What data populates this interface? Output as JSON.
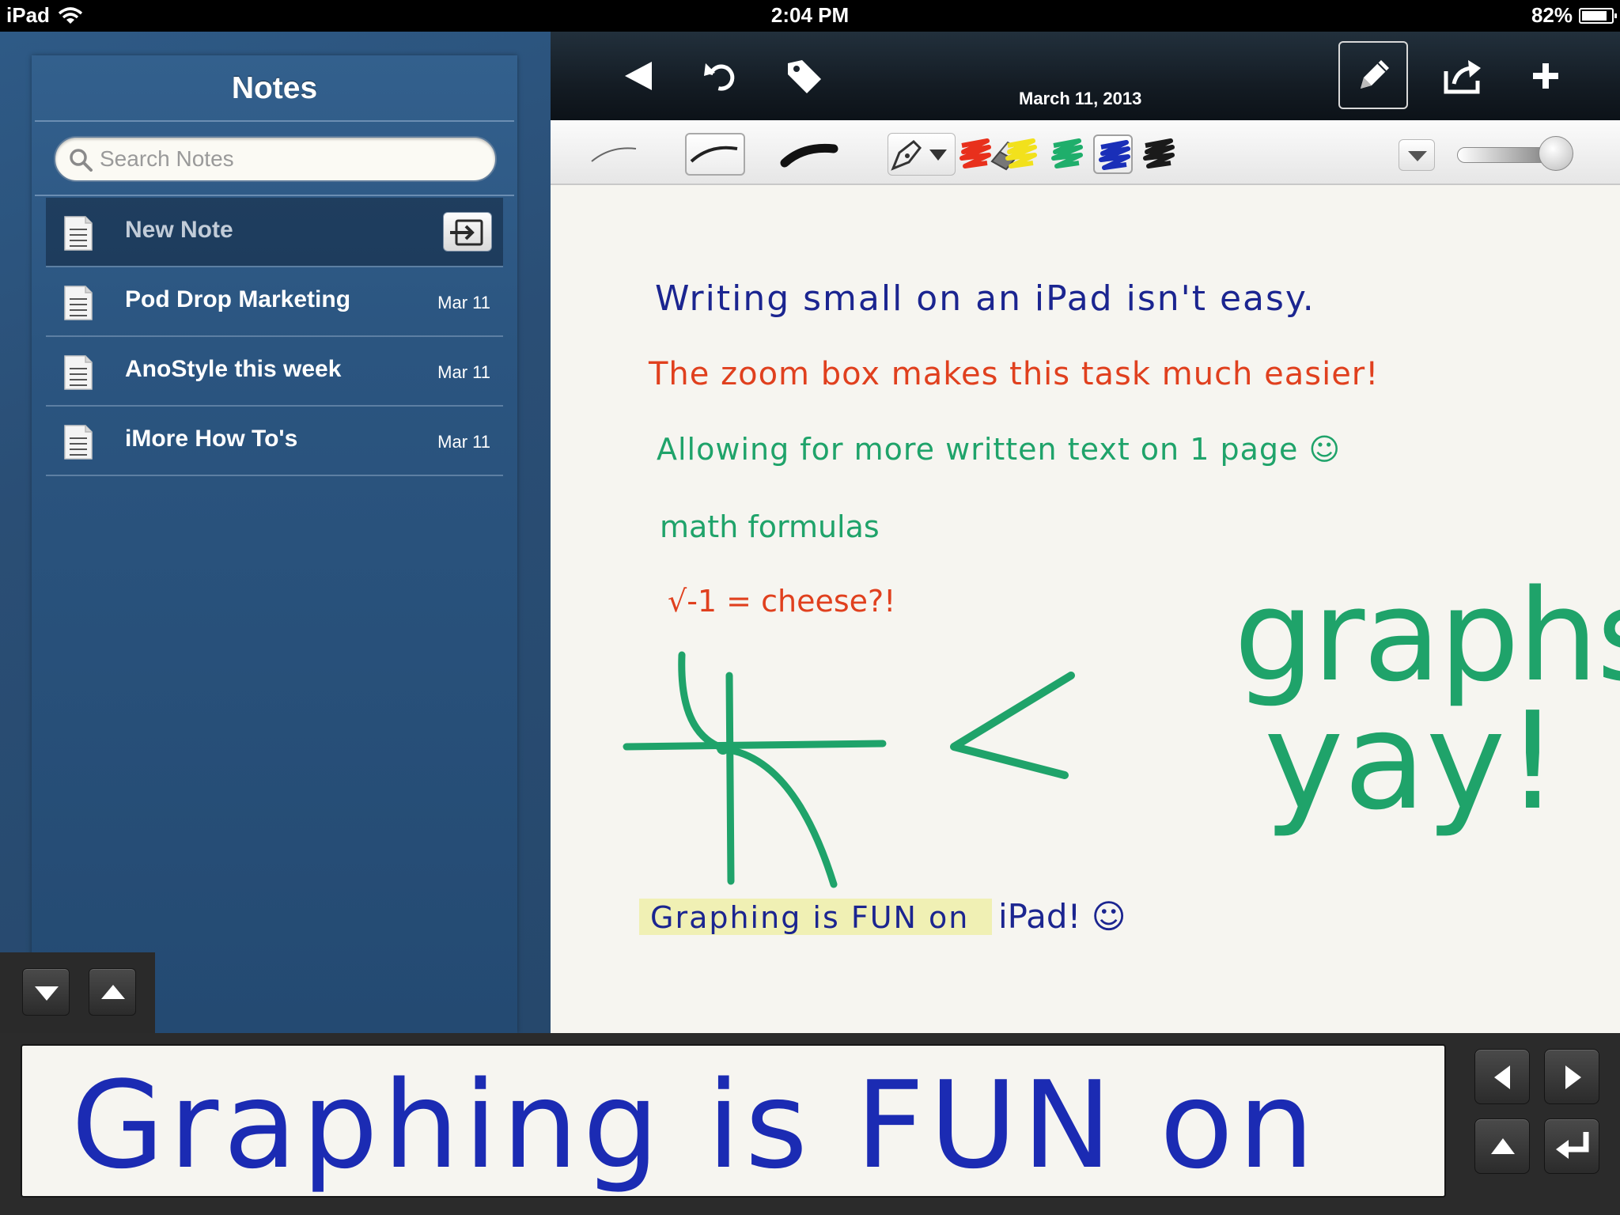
{
  "status_bar": {
    "device": "iPad",
    "time": "2:04 PM",
    "battery": "82%",
    "battery_level": 0.82
  },
  "sidebar": {
    "title": "Notes",
    "search_placeholder": "Search Notes",
    "new_note_label": "New Note",
    "notes": [
      {
        "title": "Pod Drop Marketing",
        "date": "Mar 11"
      },
      {
        "title": "AnoStyle this week",
        "date": "Mar 11"
      },
      {
        "title": "iMore How To's",
        "date": "Mar 11"
      }
    ]
  },
  "toolbar": {
    "date": "March 11, 2013",
    "icons": [
      "back-arrow-icon",
      "undo-icon",
      "tag-icon",
      "pencil-icon",
      "share-icon",
      "plus-icon"
    ]
  },
  "tools": {
    "ink_colors": [
      "#e8301c",
      "#f2e11c",
      "#1fae6b",
      "#1a2fb8",
      "#1a1a1a"
    ],
    "selected_color": "#1a2fb8",
    "pen_size_level": 0.95
  },
  "note": {
    "lines": [
      "Writing small on an iPad isn't easy.",
      "The zoom box makes this task much easier!",
      "Allowing for more written text on 1 page ☺",
      "math formulas",
      "√-1 = cheese?!",
      "graphs",
      "yay!",
      "Graphing is FUN on",
      "iPad! ☺"
    ]
  },
  "zoom_box": {
    "text": "Graphing is FUN on"
  }
}
